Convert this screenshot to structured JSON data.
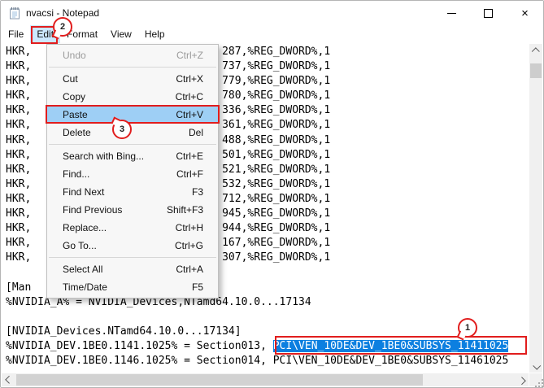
{
  "window": {
    "title": "nvacsi - Notepad",
    "controls": {
      "close_glyph": "×"
    }
  },
  "menu_bar": {
    "items": [
      "File",
      "Edit",
      "Format",
      "View",
      "Help"
    ]
  },
  "edit_menu": {
    "items": [
      {
        "label": "Undo",
        "shortcut": "Ctrl+Z"
      },
      {
        "label": "Cut",
        "shortcut": "Ctrl+X"
      },
      {
        "label": "Copy",
        "shortcut": "Ctrl+C"
      },
      {
        "label": "Paste",
        "shortcut": "Ctrl+V"
      },
      {
        "label": "Delete",
        "shortcut": "Del"
      },
      {
        "label": "Search with Bing...",
        "shortcut": "Ctrl+E"
      },
      {
        "label": "Find...",
        "shortcut": "Ctrl+F"
      },
      {
        "label": "Find Next",
        "shortcut": "F3"
      },
      {
        "label": "Find Previous",
        "shortcut": "Shift+F3"
      },
      {
        "label": "Replace...",
        "shortcut": "Ctrl+H"
      },
      {
        "label": "Go To...",
        "shortcut": "Ctrl+G"
      },
      {
        "label": "Select All",
        "shortcut": "Ctrl+A"
      },
      {
        "label": "Time/Date",
        "shortcut": "F5"
      }
    ]
  },
  "editor": {
    "lines": [
      "HKR,                              287,%REG_DWORD%,1",
      "HKR,                              737,%REG_DWORD%,1",
      "HKR,                              779,%REG_DWORD%,1",
      "HKR,                              780,%REG_DWORD%,1",
      "HKR,                              336,%REG_DWORD%,1",
      "HKR,                              361,%REG_DWORD%,1",
      "HKR,                              488,%REG_DWORD%,1",
      "HKR,                              501,%REG_DWORD%,1",
      "HKR,                              521,%REG_DWORD%,1",
      "HKR,                              532,%REG_DWORD%,1",
      "HKR,                              712,%REG_DWORD%,1",
      "HKR,                              945,%REG_DWORD%,1",
      "HKR,                              944,%REG_DWORD%,1",
      "HKR,                              167,%REG_DWORD%,1",
      "HKR,                              307,%REG_DWORD%,1",
      "",
      "[Man",
      "%NVIDIA_A% = NVIDIA_Devices,NTamd64.10.0...17134",
      "",
      "[NVIDIA_Devices.NTamd64.10.0...17134]"
    ],
    "line21_prefix": "%NVIDIA_DEV.1BE0.1141.1025% = Section013, ",
    "line21_selected": "PCI\\VEN_10DE&DEV_1BE0&SUBSYS_11411025",
    "line22": "%NVIDIA_DEV.1BE0.1146.1025% = Section014, PCI\\VEN_10DE&DEV_1BE0&SUBSYS_11461025"
  },
  "annotations": {
    "step1": "1",
    "step2": "2",
    "step3": "3"
  },
  "colors": {
    "annotation_red": "#e11d1d",
    "selection_blue": "#0c7fe0",
    "menu_highlight_blue": "#9ecff5",
    "menubar_highlight_blue": "#cce8ff"
  }
}
